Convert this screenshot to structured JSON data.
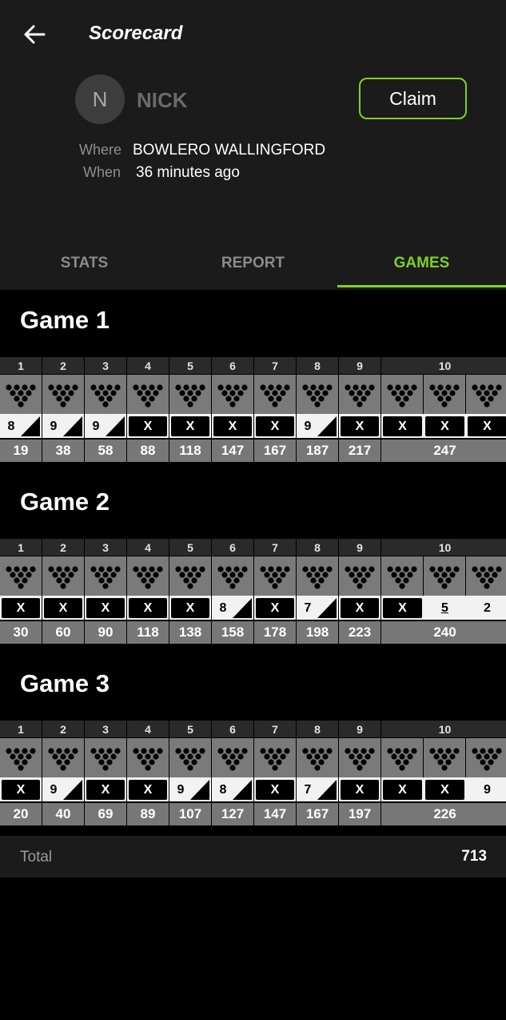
{
  "header": {
    "title": "Scorecard",
    "avatar_letter": "N",
    "player_name": "NICK",
    "claim_label": "Claim",
    "where_label": "Where",
    "where_value": "BOWLERO WALLINGFORD",
    "when_label": "When",
    "when_value": "36 minutes ago"
  },
  "tabs": [
    {
      "label": "STATS"
    },
    {
      "label": "REPORT"
    },
    {
      "label": "GAMES",
      "active": true
    }
  ],
  "colors": {
    "accent": "#7ed321",
    "header_bg": "#1b1b1b",
    "pin_box": "#7a7a7a",
    "score_bg": "#777777"
  },
  "games": [
    {
      "title": "Game 1",
      "frames": [
        {
          "n": "1",
          "shots": [
            {
              "t": "8"
            },
            {
              "t": "/"
            }
          ],
          "score": "19"
        },
        {
          "n": "2",
          "shots": [
            {
              "t": "9"
            },
            {
              "t": "/"
            }
          ],
          "score": "38"
        },
        {
          "n": "3",
          "shots": [
            {
              "t": "9"
            },
            {
              "t": "/"
            }
          ],
          "score": "58"
        },
        {
          "n": "4",
          "shots": [
            {
              "t": "X"
            }
          ],
          "score": "88"
        },
        {
          "n": "5",
          "shots": [
            {
              "t": "X"
            }
          ],
          "score": "118"
        },
        {
          "n": "6",
          "shots": [
            {
              "t": "X"
            }
          ],
          "score": "147"
        },
        {
          "n": "7",
          "shots": [
            {
              "t": "X"
            }
          ],
          "score": "167"
        },
        {
          "n": "8",
          "shots": [
            {
              "t": "9"
            },
            {
              "t": "/"
            }
          ],
          "score": "187"
        },
        {
          "n": "9",
          "shots": [
            {
              "t": "X"
            }
          ],
          "score": "217"
        },
        {
          "n": "10",
          "shots": [
            {
              "t": "X"
            },
            {
              "t": "X"
            },
            {
              "t": "X"
            }
          ],
          "score": "247"
        }
      ]
    },
    {
      "title": "Game 2",
      "frames": [
        {
          "n": "1",
          "shots": [
            {
              "t": "X"
            }
          ],
          "score": "30"
        },
        {
          "n": "2",
          "shots": [
            {
              "t": "X"
            }
          ],
          "score": "60"
        },
        {
          "n": "3",
          "shots": [
            {
              "t": "X"
            }
          ],
          "score": "90"
        },
        {
          "n": "4",
          "shots": [
            {
              "t": "X"
            }
          ],
          "score": "118"
        },
        {
          "n": "5",
          "shots": [
            {
              "t": "X"
            }
          ],
          "score": "138"
        },
        {
          "n": "6",
          "shots": [
            {
              "t": "8"
            },
            {
              "t": "/"
            }
          ],
          "score": "158"
        },
        {
          "n": "7",
          "shots": [
            {
              "t": "X"
            }
          ],
          "score": "178"
        },
        {
          "n": "8",
          "shots": [
            {
              "t": "7"
            },
            {
              "t": "/"
            }
          ],
          "score": "198"
        },
        {
          "n": "9",
          "shots": [
            {
              "t": "X"
            }
          ],
          "score": "223"
        },
        {
          "n": "10",
          "shots": [
            {
              "t": "X"
            },
            {
              "t": "5",
              "u": true
            },
            {
              "t": "2"
            }
          ],
          "score": "240"
        }
      ]
    },
    {
      "title": "Game 3",
      "frames": [
        {
          "n": "1",
          "shots": [
            {
              "t": "X"
            }
          ],
          "score": "20"
        },
        {
          "n": "2",
          "shots": [
            {
              "t": "9"
            },
            {
              "t": "/"
            }
          ],
          "score": "40"
        },
        {
          "n": "3",
          "shots": [
            {
              "t": "X"
            }
          ],
          "score": "69"
        },
        {
          "n": "4",
          "shots": [
            {
              "t": "X"
            }
          ],
          "score": "89"
        },
        {
          "n": "5",
          "shots": [
            {
              "t": "9"
            },
            {
              "t": "/"
            }
          ],
          "score": "107"
        },
        {
          "n": "6",
          "shots": [
            {
              "t": "8"
            },
            {
              "t": "/"
            }
          ],
          "score": "127"
        },
        {
          "n": "7",
          "shots": [
            {
              "t": "X"
            }
          ],
          "score": "147"
        },
        {
          "n": "8",
          "shots": [
            {
              "t": "7"
            },
            {
              "t": "/"
            }
          ],
          "score": "167"
        },
        {
          "n": "9",
          "shots": [
            {
              "t": "X"
            }
          ],
          "score": "197"
        },
        {
          "n": "10",
          "shots": [
            {
              "t": "X"
            },
            {
              "t": "X"
            },
            {
              "t": "9"
            }
          ],
          "score": "226"
        }
      ]
    }
  ],
  "total": {
    "label": "Total",
    "value": "713"
  }
}
